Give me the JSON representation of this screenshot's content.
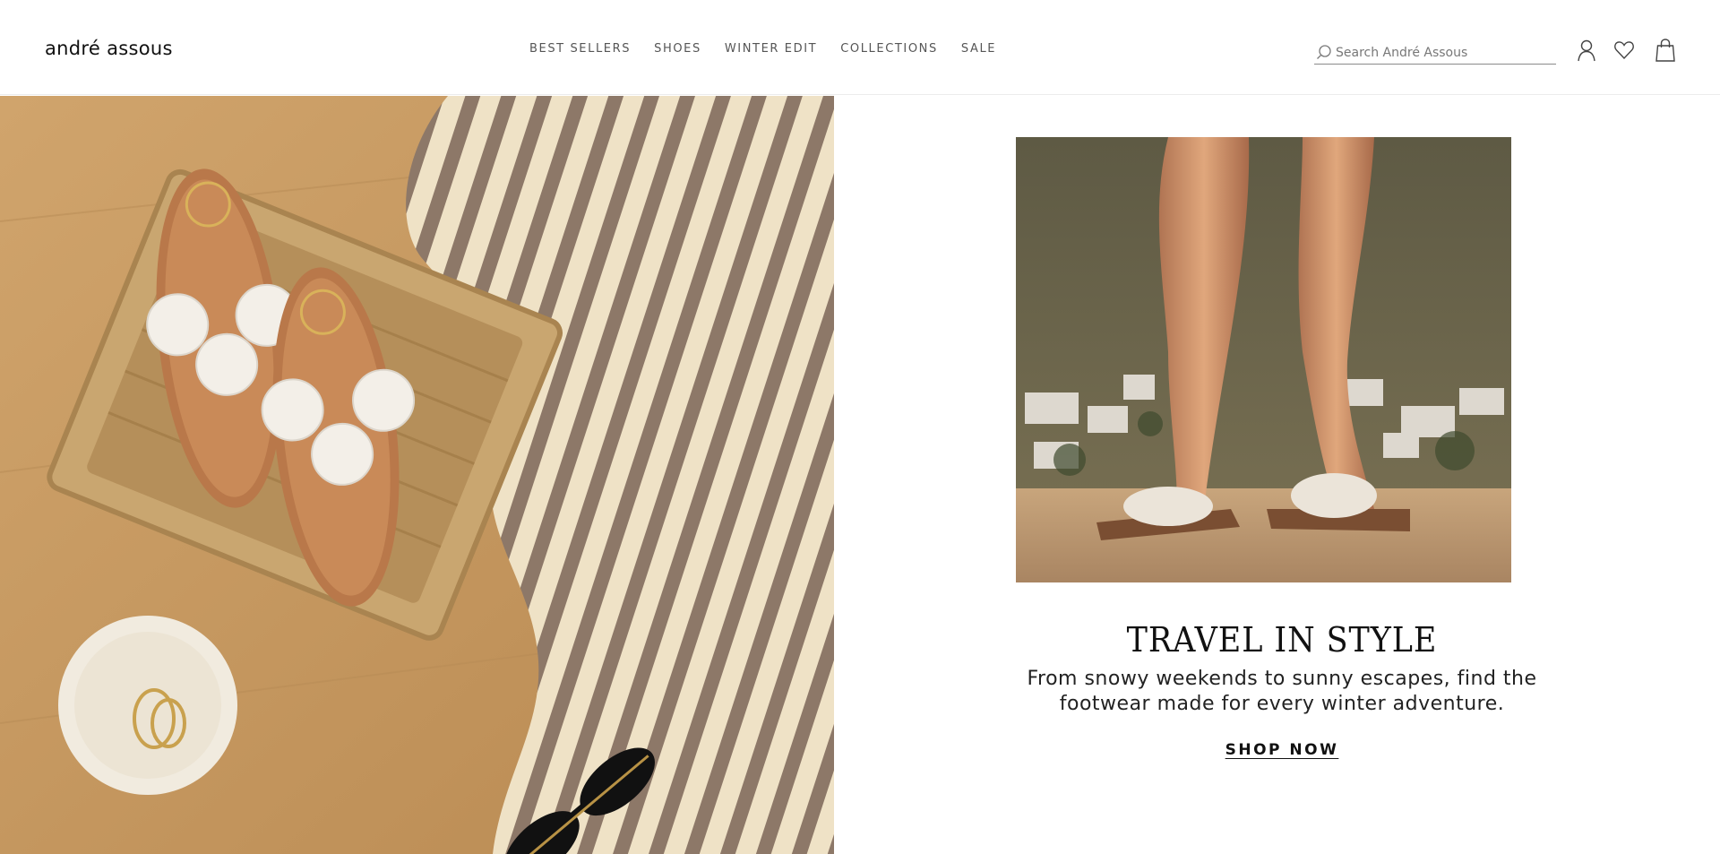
{
  "header": {
    "logo": "andré assous",
    "nav": [
      "BEST SELLERS",
      "SHOES",
      "WINTER EDIT",
      "COLLECTIONS",
      "SALE"
    ],
    "search_placeholder": "Search André Assous",
    "icons": [
      "search-icon",
      "account-icon",
      "wishlist-heart-icon",
      "shopping-bag-icon"
    ]
  },
  "hero": {
    "headline": "TRAVEL IN STYLE",
    "subtext_line1": "From snowy weekends to sunny escapes, find the",
    "subtext_line2": "footwear made for every winter adventure.",
    "cta": "SHOP NOW"
  },
  "colors": {
    "text": "#111111",
    "nav_text": "#555555",
    "background": "#ffffff"
  }
}
